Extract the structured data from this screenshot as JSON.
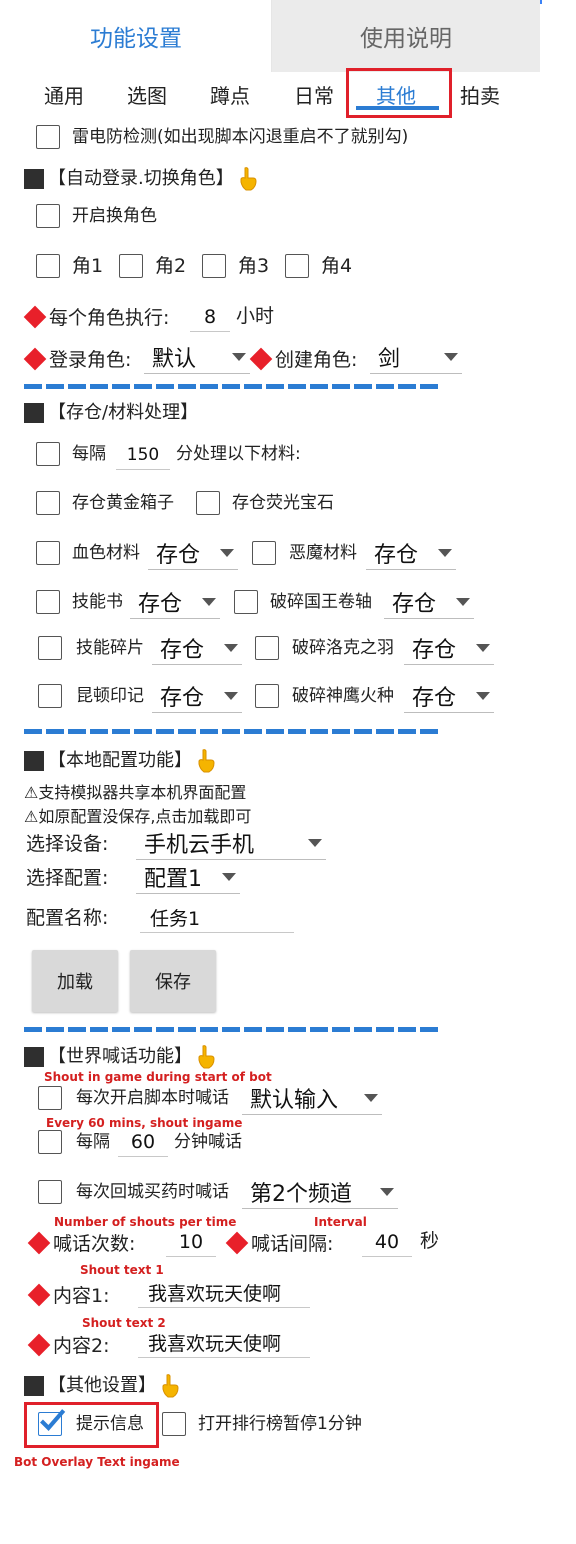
{
  "main_tabs": {
    "settings": "功能设置",
    "help": "使用说明"
  },
  "sub_tabs": [
    "通用",
    "选图",
    "蹲点",
    "日常",
    "其他",
    "拍卖"
  ],
  "thunder": {
    "label": "雷电防检测(如出现脚本闪退重启不了就别勾)"
  },
  "auto_login": {
    "title": "【自动登录.切换角色】",
    "enable": "开启换角色",
    "roles": [
      "角1",
      "角2",
      "角3",
      "角4"
    ],
    "per_role_label": "每个角色执行:",
    "per_role_value": "8",
    "per_role_unit": "小时",
    "login_label": "登录角色:",
    "login_value": "默认",
    "create_label": "创建角色:",
    "create_value": "剑"
  },
  "storage": {
    "title": "【存仓/材料处理】",
    "every_prefix": "每隔",
    "every_value": "150",
    "every_suffix": "分处理以下材料:",
    "gold_box": "存仓黄金箱子",
    "gem": "存仓荧光宝石",
    "items": [
      {
        "label": "血色材料",
        "value": "存仓"
      },
      {
        "label": "恶魔材料",
        "value": "存仓"
      },
      {
        "label": "技能书",
        "value": "存仓"
      },
      {
        "label": "破碎国王卷轴",
        "value": "存仓"
      },
      {
        "label": "技能碎片",
        "value": "存仓"
      },
      {
        "label": "破碎洛克之羽",
        "value": "存仓"
      },
      {
        "label": "昆顿印记",
        "value": "存仓"
      },
      {
        "label": "破碎神鹰火种",
        "value": "存仓"
      }
    ]
  },
  "local_config": {
    "title": "【本地配置功能】",
    "note1": "⚠支持模拟器共享本机界面配置",
    "note2": "⚠如原配置没保存,点击加载即可",
    "device_label": "选择设备:",
    "device_value": "手机云手机",
    "config_label": "选择配置:",
    "config_value": "配置1",
    "name_label": "配置名称:",
    "name_value": "任务1",
    "load": "加载",
    "save": "保存"
  },
  "world_shout": {
    "title": "【世界喊话功能】",
    "on_start": "每次开启脚本时喊话",
    "on_start_value": "默认输入",
    "every_prefix": "每隔",
    "every_value": "60",
    "every_suffix": "分钟喊话",
    "on_return": "每次回城买药时喊话",
    "on_return_value": "第2个频道",
    "count_label": "喊话次数:",
    "count_value": "10",
    "interval_label": "喊话间隔:",
    "interval_value": "40",
    "interval_unit": "秒",
    "content1_label": "内容1:",
    "content1_value": "我喜欢玩天使啊",
    "content2_label": "内容2:",
    "content2_value": "我喜欢玩天使啊"
  },
  "other_settings": {
    "title": "【其他设置】",
    "hint": "提示信息",
    "ranking": "打开排行榜暂停1分钟"
  },
  "annotations": {
    "shout_start": "Shout in game during start of bot",
    "every_60": "Every 60 mins, shout ingame",
    "num_shouts": "Number of shouts per time",
    "interval": "Interval",
    "text1": "Shout text 1",
    "text2": "Shout text 2",
    "overlay": "Bot Overlay Text ingame"
  },
  "colors": {
    "accent": "#2b7cd3",
    "red": "#e0202a",
    "annotation": "#d42020"
  }
}
